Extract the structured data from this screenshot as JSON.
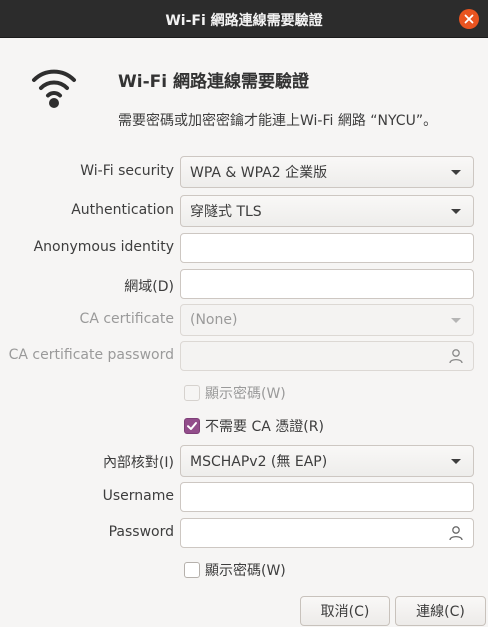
{
  "window": {
    "title": "Wi-Fi 網路連線需要驗證"
  },
  "header": {
    "heading": "Wi-Fi 網路連線需要驗證",
    "message": "需要密碼或加密密鑰才能連上Wi-Fi 網路 “NYCU”。"
  },
  "form": {
    "wifi_security": {
      "label": "Wi-Fi security",
      "value": "WPA & WPA2 企業版"
    },
    "authentication": {
      "label": "Authentication",
      "value": "穿隧式 TLS"
    },
    "anonymous_identity": {
      "label": "Anonymous identity",
      "value": ""
    },
    "domain": {
      "label": "網域(D)",
      "value": ""
    },
    "ca_certificate": {
      "label": "CA certificate",
      "value": "(None)"
    },
    "ca_certificate_password": {
      "label": "CA certificate password",
      "value": ""
    },
    "show_ca_password": {
      "label": "顯示密碼(W)",
      "checked": false,
      "enabled": false
    },
    "no_ca_cert_required": {
      "label": "不需要 CA 憑證(R)",
      "checked": true
    },
    "inner_auth": {
      "label": "內部核對(I)",
      "value": "MSCHAPv2 (無 EAP)"
    },
    "username": {
      "label": "Username",
      "value": ""
    },
    "password": {
      "label": "Password",
      "value": ""
    },
    "show_password": {
      "label": "顯示密碼(W)",
      "checked": false
    }
  },
  "buttons": {
    "cancel": "取消(C)",
    "connect": "連線(C)"
  },
  "colors": {
    "titlebar": "#2c2c2c",
    "close_button": "#e95420",
    "checkbox_checked": "#924d8b"
  }
}
